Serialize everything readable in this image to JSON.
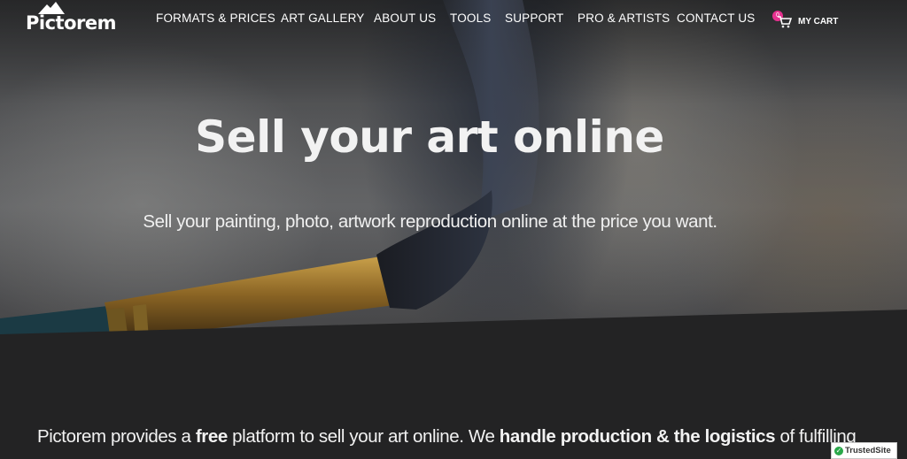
{
  "brand": {
    "name": "Pictorem",
    "logo_icon": "mountain-logo-icon"
  },
  "nav": {
    "items": [
      {
        "label": "FORMATS & PRICES"
      },
      {
        "label": "ART GALLERY"
      },
      {
        "label": "ABOUT US"
      },
      {
        "label": "TOOLS"
      },
      {
        "label": "SUPPORT"
      },
      {
        "label": "PRO & ARTISTS"
      },
      {
        "label": "CONTACT US"
      }
    ]
  },
  "cart": {
    "count": "0",
    "label": "MY CART",
    "icon": "shopping-cart-icon",
    "badge_color": "#e6318f"
  },
  "hero": {
    "title": "Sell your art online",
    "subtitle": "Sell your painting, photo, artwork reproduction online at the price you want."
  },
  "intro": {
    "part1": "Pictorem provides a ",
    "bold1": "free",
    "part2": " platform to sell your art online. We ",
    "bold2": "handle production & the logistics",
    "part3": " of fulfilling"
  },
  "trust_badge": {
    "label": "TrustedSite",
    "icon": "check-circle-icon",
    "color": "#2aa84a"
  },
  "colors": {
    "background_dark": "#232324",
    "text": "#ffffff",
    "accent_pink": "#e6318f"
  }
}
